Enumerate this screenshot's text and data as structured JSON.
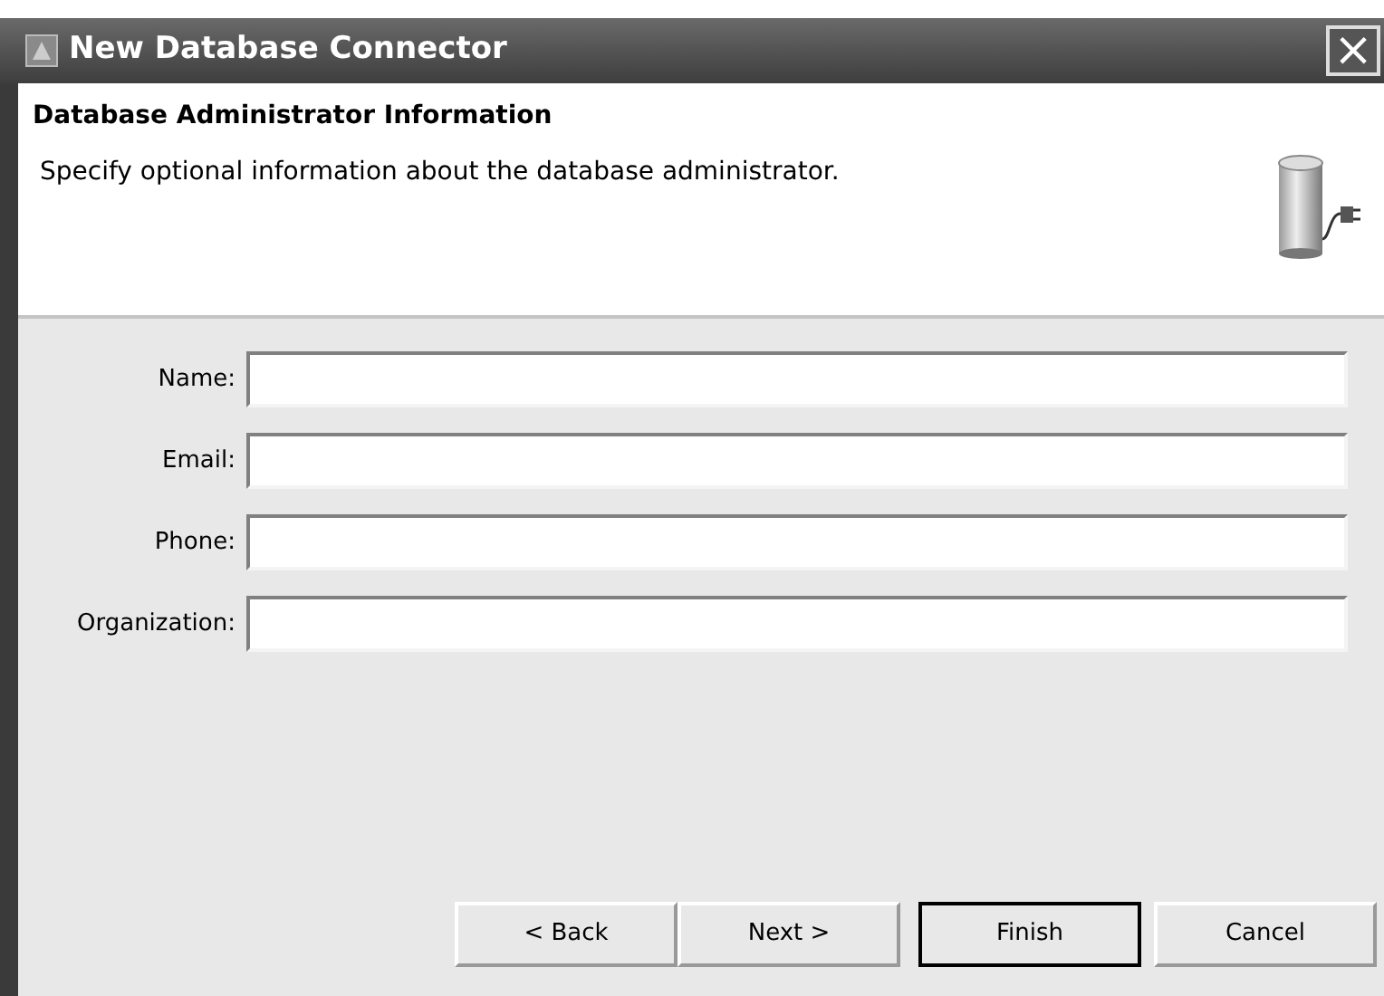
{
  "window": {
    "title": "New Database Connector",
    "close": "×"
  },
  "header": {
    "title": "Database Administrator Information",
    "description": "Specify optional information about the database administrator."
  },
  "fields": [
    {
      "label": "Name:"
    },
    {
      "label": "Email:"
    },
    {
      "label": "Phone:"
    },
    {
      "label": "Organization:"
    }
  ],
  "buttons": [
    {
      "label": "< Back",
      "default": false
    },
    {
      "label": "Next >",
      "default": false
    },
    {
      "label": "Finish",
      "default": true
    },
    {
      "label": "Cancel",
      "default": false
    }
  ]
}
